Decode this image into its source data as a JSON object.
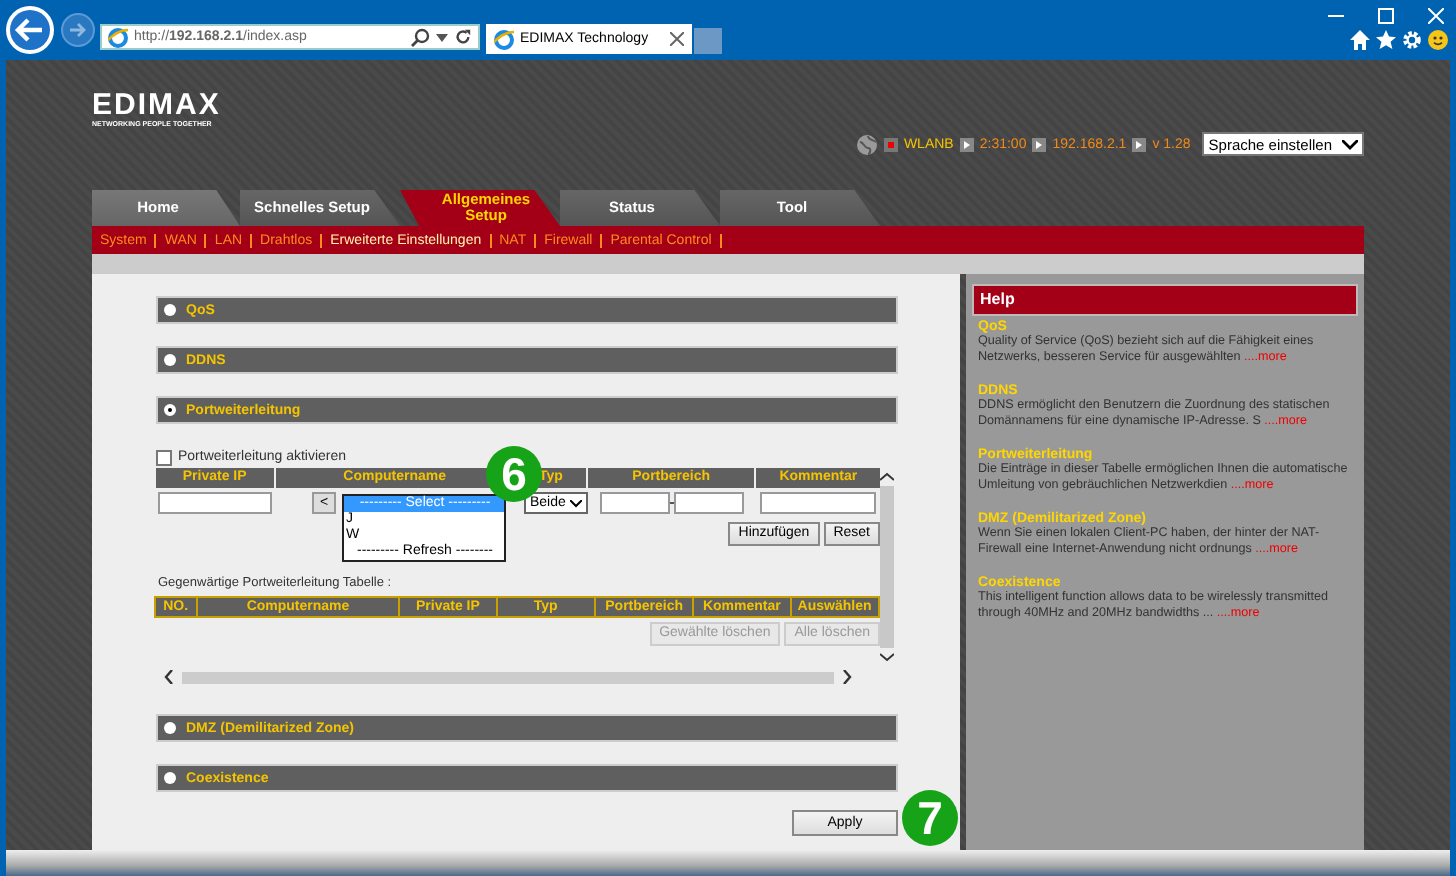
{
  "browser": {
    "url": "http://**192.168.2.1**/index.asp",
    "tab_title": "EDIMAX Technology"
  },
  "logo": {
    "name": "EDIMAX",
    "tagline": "NETWORKING PEOPLE TOGETHER"
  },
  "status": {
    "wlan": "WLANB",
    "uptime": "2:31:00",
    "ip": "192.168.2.1",
    "version": "v 1.28",
    "language": "Sprache einstellen"
  },
  "tabs": [
    {
      "label": "Home",
      "selected": false
    },
    {
      "label": "Schnelles Setup",
      "selected": false
    },
    {
      "label": "Allgemeines Setup",
      "selected": true
    },
    {
      "label": "Status",
      "selected": false
    },
    {
      "label": "Tool",
      "selected": false
    }
  ],
  "subnav": [
    {
      "label": "System",
      "selected": false
    },
    {
      "label": "WAN",
      "selected": false
    },
    {
      "label": "LAN",
      "selected": false
    },
    {
      "label": "Drahtlos",
      "selected": false
    },
    {
      "label": "Erweiterte Einstellungen",
      "selected": true
    },
    {
      "label": "NAT",
      "selected": false
    },
    {
      "label": "Firewall",
      "selected": false
    },
    {
      "label": "Parental Control",
      "selected": false
    }
  ],
  "sections": [
    {
      "title": "QoS",
      "selected": false
    },
    {
      "title": "DDNS",
      "selected": false
    },
    {
      "title": "Portweiterleitung",
      "selected": true
    },
    {
      "title": "DMZ (Demilitarized Zone)",
      "selected": false
    },
    {
      "title": "Coexistence",
      "selected": false
    }
  ],
  "port_forwarding": {
    "enable_label": "Portweiterleitung aktivieren",
    "enabled": false,
    "columns": [
      "Private IP",
      "Computername",
      "Typ",
      "Portbereich",
      "Kommentar"
    ],
    "copy_button": "<",
    "type_value": "Beide",
    "computer_options": [
      {
        "label": "--------- Select ---------",
        "selected": true
      },
      {
        "label": "J",
        "selected": false
      },
      {
        "label": "W",
        "selected": false
      },
      {
        "label": "--------- Refresh --------",
        "selected": false
      }
    ],
    "add_button": "Hinzufügen",
    "reset_button": "Reset",
    "table_caption": "Gegenwärtige Portweiterleitung Tabelle :",
    "table_columns": [
      "NO.",
      "Computername",
      "Private IP",
      "Typ",
      "Portbereich",
      "Kommentar",
      "Auswählen"
    ],
    "delete_selected": {
      "label": "Gewählte löschen",
      "disabled": true
    },
    "delete_all": {
      "label": "Alle löschen",
      "disabled": true
    }
  },
  "apply_button": "Apply",
  "help": {
    "title": "Help",
    "items": [
      {
        "title": "QoS",
        "text": "Quality of Service (QoS) bezieht sich auf die Fähigkeit eines Netzwerks, besseren Service für ausgewählten",
        "more": "....more"
      },
      {
        "title": "DDNS",
        "text": "DDNS ermöglicht den Benutzern die Zuordnung des statischen Domännamens für eine dynamische IP-Adresse. S",
        "more": "....more"
      },
      {
        "title": "Portweiterleitung",
        "text": "Die Einträge in dieser Tabelle ermöglichen Ihnen die automatische Umleitung von gebräuchlichen Netzwerkdien",
        "more": "....more"
      },
      {
        "title": "DMZ (Demilitarized Zone)",
        "text": "Wenn Sie einen lokalen Client-PC haben, der hinter der NAT-Firewall eine Internet-Anwendung nicht ordnungs",
        "more": "....more"
      },
      {
        "title": "Coexistence",
        "text": "This intelligent function allows data to be wirelessly transmitted through 40MHz and 20MHz bandwidths ...",
        "more": "....more"
      }
    ]
  },
  "markers": [
    "6",
    "7"
  ]
}
